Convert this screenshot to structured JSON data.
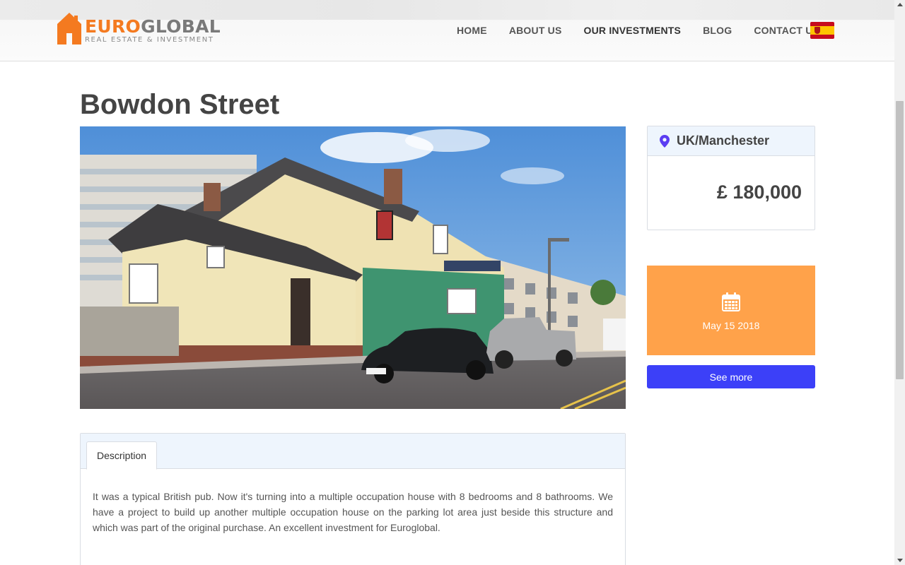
{
  "header": {
    "logo": {
      "part1": "EURO",
      "part2": "GLOBAL",
      "tagline": "REAL ESTATE & INVESTMENT"
    },
    "nav": [
      {
        "label": "HOME"
      },
      {
        "label": "ABOUT US"
      },
      {
        "label": "OUR INVESTMENTS",
        "active": true
      },
      {
        "label": "BLOG"
      },
      {
        "label": "CONTACT US"
      }
    ],
    "language_flag": "spain-flag-icon"
  },
  "property": {
    "title": "Bowdon Street",
    "location": "UK/Manchester",
    "price": "£ 180,000",
    "date": "May 15 2018",
    "see_more_label": "See more"
  },
  "tabs": [
    {
      "label": "Description",
      "active": true
    }
  ],
  "description": "It was a typical British pub. Now it's turning into a multiple occupation house with 8 bedrooms and 8 bathrooms. We have a project to build up another multiple occupation house on the parking lot area just beside this structure and which was part of the original purchase. An excellent investment for Euroglobal.",
  "icons": {
    "location": "map-pin-icon",
    "calendar": "calendar-icon"
  },
  "colors": {
    "brand_orange": "#f47a20",
    "date_box": "#ffa24a",
    "button_blue": "#3c40f8",
    "panel_header": "#eef5fd"
  }
}
